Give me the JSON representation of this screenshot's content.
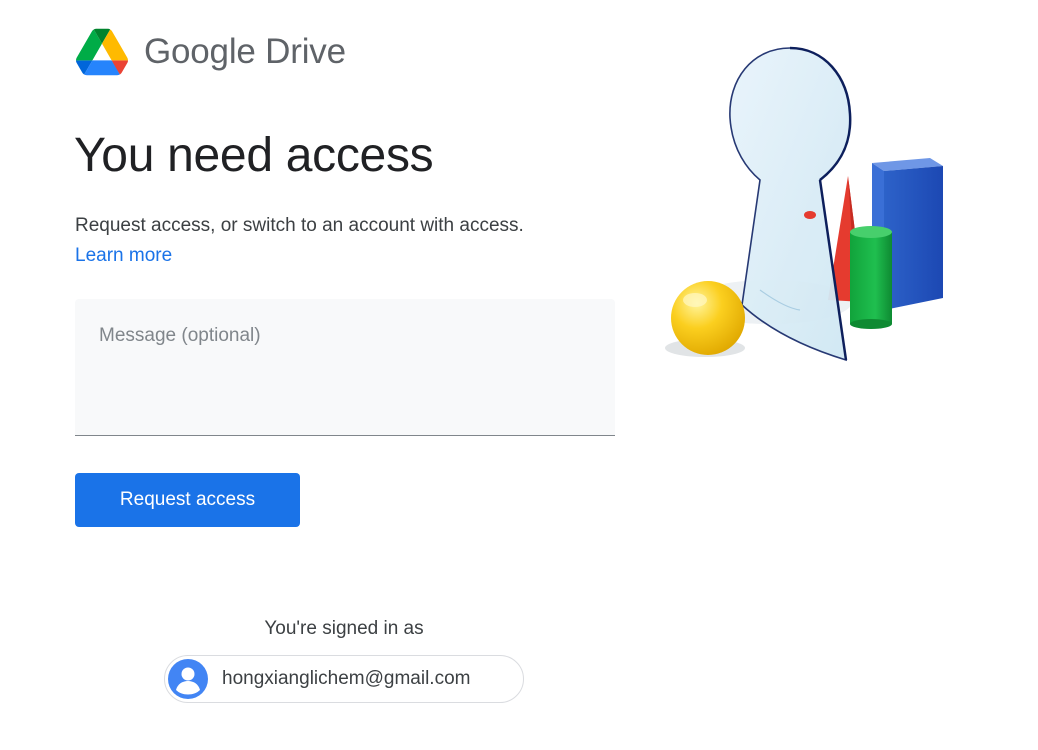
{
  "brand": {
    "name": "Google Drive",
    "icon": "google-drive-logo-icon"
  },
  "main": {
    "title": "You need access",
    "description": "Request access, or switch to an account with access.",
    "learn_more": "Learn more",
    "message_placeholder": "Message (optional)",
    "message_value": "",
    "request_button": "Request access"
  },
  "account": {
    "signed_in_label": "You're signed in as",
    "email": "hongxianglichem@gmail.com",
    "avatar_icon": "person-icon"
  },
  "colors": {
    "primary_blue": "#1a73e8",
    "text_dark": "#202124",
    "text_secondary": "#3c4043",
    "field_background": "#f8f9fa"
  }
}
